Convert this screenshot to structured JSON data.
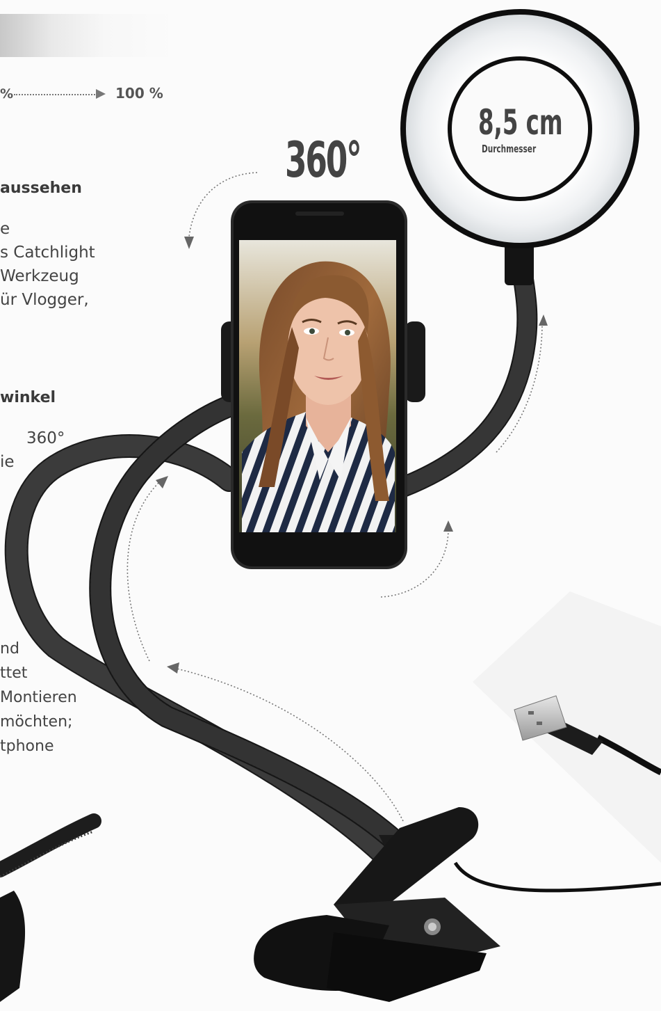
{
  "progress": {
    "left_label": "%",
    "right_label": "100 %"
  },
  "section1": {
    "heading": "aussehen",
    "lines": [
      "e",
      "s Catchlight",
      "Werkzeug",
      "ür Vlogger,"
    ]
  },
  "section2": {
    "heading": "winkel",
    "lines": [
      "360°",
      "ie"
    ]
  },
  "section3": {
    "lines": [
      "nd",
      "ttet",
      "Montieren",
      "möchten;",
      "tphone"
    ]
  },
  "rotation": {
    "label": "360°"
  },
  "ring_light": {
    "diameter_value": "8,5 cm",
    "diameter_label": "Durchmesser"
  },
  "colors": {
    "accent": "#3a3a3a",
    "ring_glow": "#f4f5f6",
    "arm": "#1b1b1b"
  }
}
